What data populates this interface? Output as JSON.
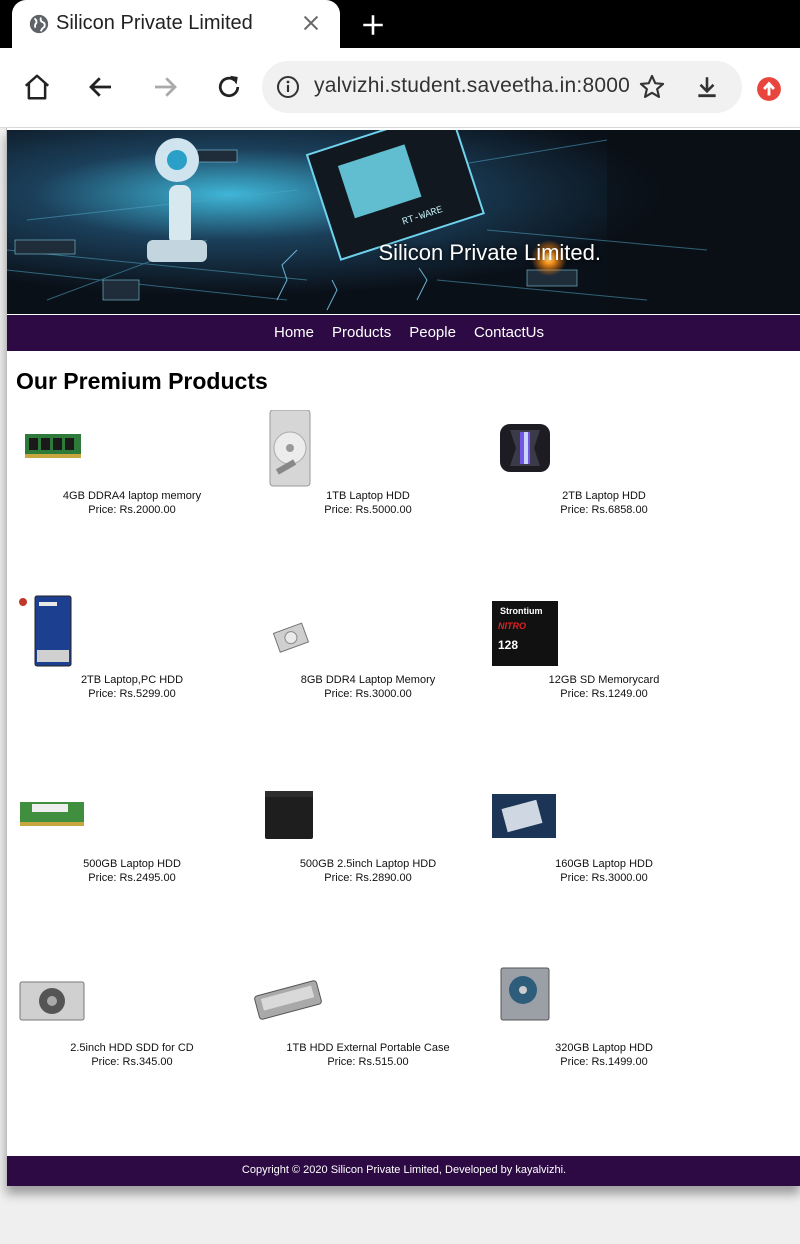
{
  "browser": {
    "tab_title": "Silicon Private Limited",
    "url": "yalvizhi.student.saveetha.in:8000"
  },
  "site": {
    "banner_title": "Silicon Private Limited.",
    "nav": [
      "Home",
      "Products",
      "People",
      "ContactUs"
    ],
    "heading": "Our Premium Products",
    "footer": "Copyright © 2020 Silicon Private Limited, Developed by kayalvizhi."
  },
  "products": [
    {
      "name": "4GB DDRA4 laptop memory",
      "price": "Price: Rs.2000.00",
      "icon": "ram-stick"
    },
    {
      "name": "1TB Laptop HDD",
      "price": "Price: Rs.5000.00",
      "icon": "open-hdd"
    },
    {
      "name": "2TB Laptop HDD",
      "price": "Price: Rs.6858.00",
      "icon": "rgb-drive"
    },
    {
      "name": "2TB Laptop,PC HDD",
      "price": "Price: Rs.5299.00",
      "icon": "blue-hdd"
    },
    {
      "name": "8GB DDR4 Laptop Memory",
      "price": "Price: Rs.3000.00",
      "icon": "small-hdd"
    },
    {
      "name": "12GB SD Memorycard",
      "price": "Price: Rs.1249.00",
      "icon": "sd-card"
    },
    {
      "name": "500GB Laptop HDD",
      "price": "Price: Rs.2495.00",
      "icon": "ram-stick"
    },
    {
      "name": "500GB 2.5inch Laptop HDD",
      "price": "Price: Rs.2890.00",
      "icon": "black-drive"
    },
    {
      "name": "160GB Laptop HDD",
      "price": "Price: Rs.3000.00",
      "icon": "hdd-photo"
    },
    {
      "name": "2.5inch HDD SDD for CD",
      "price": "Price: Rs.345.00",
      "icon": "caddy"
    },
    {
      "name": "1TB HDD External Portable Case",
      "price": "Price: Rs.515.00",
      "icon": "enclosure"
    },
    {
      "name": "320GB Laptop HDD",
      "price": "Price: Rs.1499.00",
      "icon": "hdd-top"
    }
  ],
  "sd_card_text": {
    "brand": "Strontium",
    "line": "NITRO",
    "cap": "128"
  }
}
